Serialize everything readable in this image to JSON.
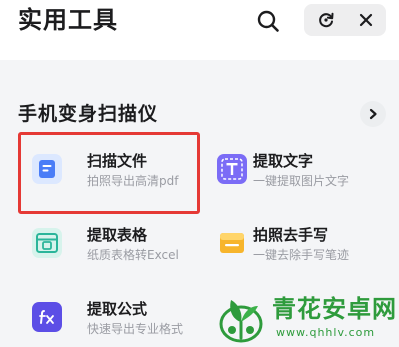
{
  "header": {
    "title": "实用工具",
    "search_icon": "search-icon",
    "capsule_icons": [
      "refresh-icon",
      "close-icon"
    ]
  },
  "section": {
    "title": "手机变身扫描仪",
    "more_icon": "chevron-right-icon"
  },
  "tools": [
    {
      "name": "扫描文件",
      "desc": "拍照导出高清pdf",
      "icon": "document-scan-icon",
      "color": "#4a7df7",
      "highlighted": true
    },
    {
      "name": "提取文字",
      "desc": "一键提取图片文字",
      "icon": "text-extract-icon",
      "color": "#7b6cf6"
    },
    {
      "name": "提取表格",
      "desc": "纸质表格转Excel",
      "icon": "table-extract-icon",
      "color": "#2bb59a"
    },
    {
      "name": "拍照去手写",
      "desc": "一键去除手写笔迹",
      "icon": "eraser-icon",
      "color": "#f7b52c"
    },
    {
      "name": "提取公式",
      "desc": "快速导出专业格式",
      "icon": "formula-icon",
      "color": "#5c4ee6"
    }
  ],
  "watermark": {
    "name": "青花安卓网",
    "url": "www.qhhlv.com"
  }
}
